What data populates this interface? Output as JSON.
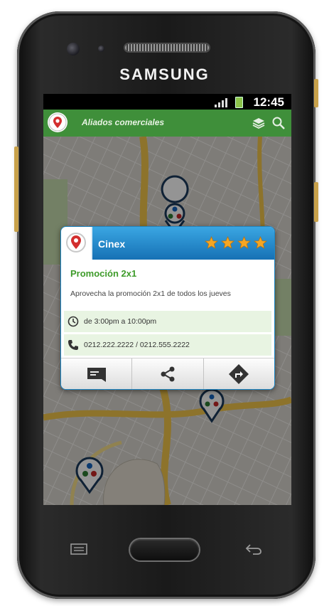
{
  "device": {
    "brand": "SAMSUNG"
  },
  "status_bar": {
    "time": "12:45"
  },
  "action_bar": {
    "title": "Aliados comerciales",
    "icons": [
      "layers-icon",
      "search-icon"
    ]
  },
  "card": {
    "name": "Cinex",
    "rating": 4,
    "rating_max": 4,
    "promo_title": "Promoción 2x1",
    "promo_text": "Aprovecha la promoción 2x1 de todos los jueves",
    "schedule": "de 3:00pm a 10:00pm",
    "phones": "0212.222.2222 / 0212.555.2222",
    "actions": [
      "message-icon",
      "share-icon",
      "directions-icon"
    ]
  },
  "colors": {
    "action_bar": "#3f8f3a",
    "card_header": "#1e88c7",
    "promo_title": "#3e9b2a",
    "star": "#f5a623"
  }
}
